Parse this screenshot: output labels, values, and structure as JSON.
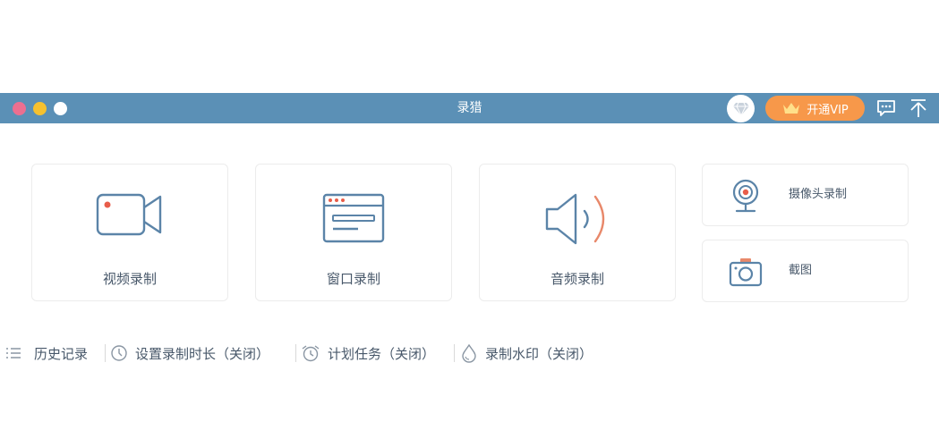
{
  "window": {
    "title": "录猎",
    "vip_label": "开通VIP"
  },
  "cards": [
    {
      "label": "视频录制",
      "icon": "video-camera-icon"
    },
    {
      "label": "窗口录制",
      "icon": "window-icon"
    },
    {
      "label": "音频录制",
      "icon": "speaker-icon"
    }
  ],
  "side_cards": [
    {
      "label": "摄像头录制",
      "icon": "webcam-icon"
    },
    {
      "label": "截图",
      "icon": "camera-icon"
    }
  ],
  "bottom": {
    "history": "历史记录",
    "duration": "设置录制时长（关闭）",
    "schedule": "计划任务（关闭）",
    "watermark": "录制水印（关闭）"
  },
  "colors": {
    "titlebar": "#5b90b6",
    "vip": "#f7984a",
    "accent_red": "#e85d4a",
    "icon_blue": "#5b84a8"
  }
}
